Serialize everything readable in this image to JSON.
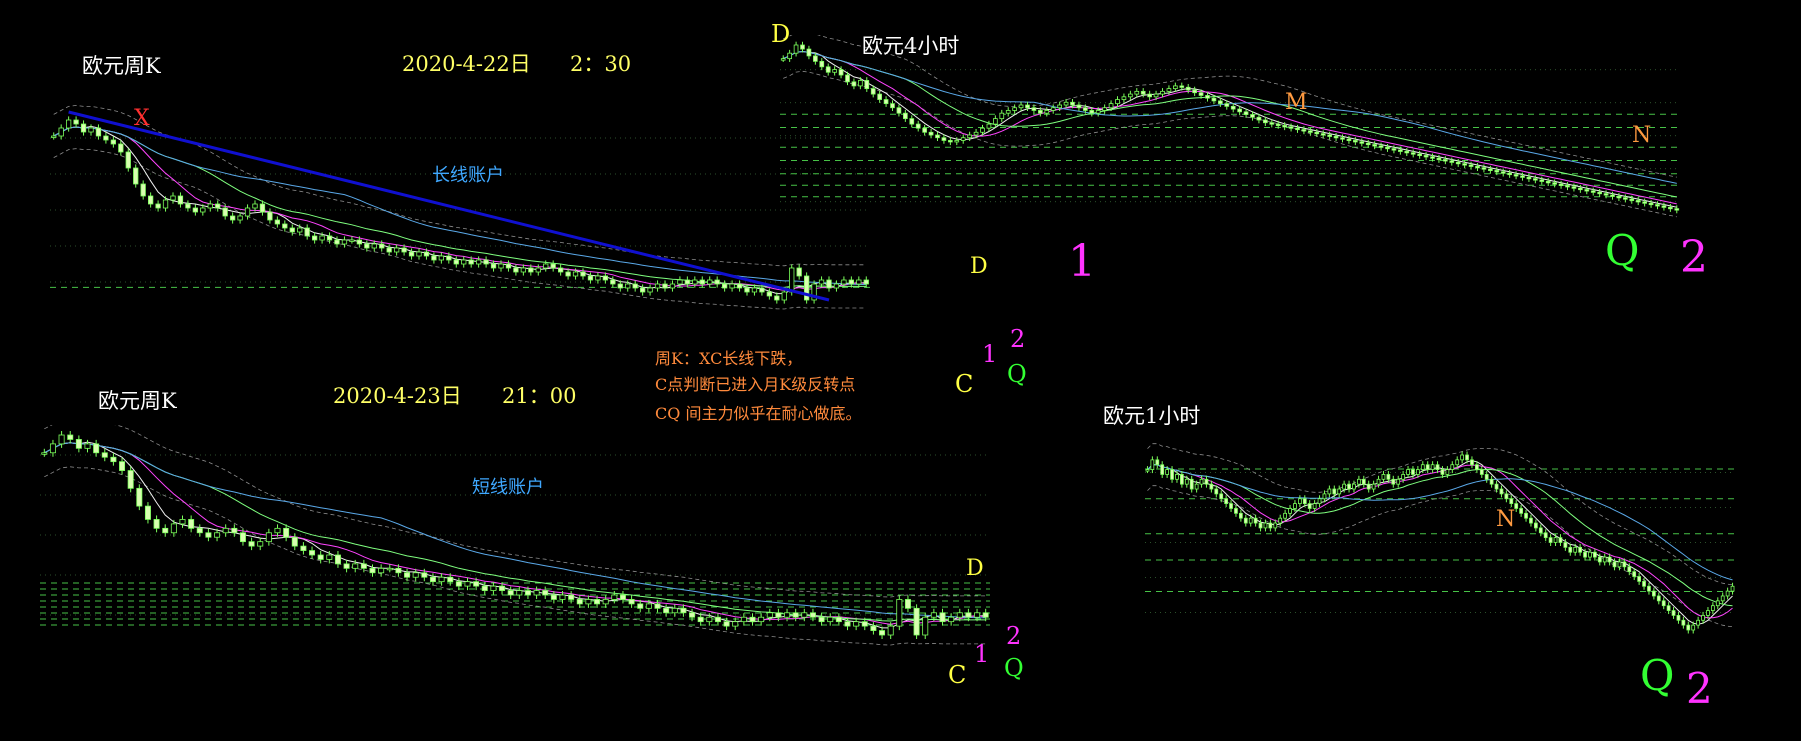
{
  "colors": {
    "background": "#000000",
    "candle": "#d8ffb0",
    "candle_border": "#7bff5a",
    "grid": "#3a6b3a",
    "level": "#47c247",
    "trend": "#1010d0",
    "ma_white": "#f0f0f0",
    "ma_magenta": "#ff44ff",
    "ma_green": "#7fff7f",
    "ma_blue": "#5aa8e8",
    "band": "#8c8c8c",
    "label_x": "#ff3030",
    "label_yellow": "#ffff44",
    "label_orange": "#ff9a40",
    "label_magenta": "#ff33ff",
    "label_green": "#33ff33",
    "account_text": "#3fa8ff",
    "note_text": "#ff8a3c"
  },
  "panel_weekly_top": {
    "title": "欧元周K",
    "date": "2020-4-22日",
    "time": "2：30",
    "account": "长线账户",
    "marker_x": "X",
    "marker_d": "D",
    "marker_c": "C",
    "marker_1": "1",
    "marker_2": "2",
    "marker_q": "Q"
  },
  "panel_4h": {
    "title": "欧元4小时",
    "marker_d": "D",
    "marker_m": "M",
    "marker_n": "N",
    "marker_1": "1",
    "marker_q": "Q",
    "marker_2": "2"
  },
  "panel_weekly_bottom": {
    "title": "欧元周K",
    "date": "2020-4-23日",
    "time": "21：00",
    "account": "短线账户",
    "marker_d": "D",
    "marker_c": "C",
    "marker_1": "1",
    "marker_2": "2",
    "marker_q": "Q"
  },
  "panel_1h": {
    "title": "欧元1小时",
    "marker_n": "N",
    "marker_q": "Q",
    "marker_2": "2"
  },
  "annotation": {
    "line1": "周K：XC长线下跌，",
    "line2": "C点判断已进入月K级反转点",
    "line3": "CQ 间主力似乎在耐心做底。"
  },
  "chart_data": [
    {
      "type": "candlestick",
      "panel": "weekly_top",
      "title": "欧元周K",
      "trendline": [
        "X",
        "C"
      ],
      "candles": 110,
      "close": [
        1.45,
        1.47,
        1.49,
        1.48,
        1.46,
        1.47,
        1.45,
        1.44,
        1.43,
        1.41,
        1.37,
        1.33,
        1.3,
        1.28,
        1.27,
        1.29,
        1.3,
        1.28,
        1.27,
        1.26,
        1.27,
        1.28,
        1.27,
        1.25,
        1.24,
        1.25,
        1.27,
        1.28,
        1.26,
        1.24,
        1.23,
        1.22,
        1.21,
        1.22,
        1.2,
        1.19,
        1.2,
        1.19,
        1.18,
        1.19,
        1.19,
        1.18,
        1.17,
        1.18,
        1.17,
        1.16,
        1.17,
        1.16,
        1.15,
        1.16,
        1.15,
        1.14,
        1.15,
        1.14,
        1.13,
        1.14,
        1.13,
        1.14,
        1.13,
        1.12,
        1.13,
        1.12,
        1.11,
        1.12,
        1.11,
        1.12,
        1.13,
        1.12,
        1.11,
        1.1,
        1.11,
        1.1,
        1.09,
        1.1,
        1.09,
        1.08,
        1.07,
        1.08,
        1.07,
        1.06,
        1.07,
        1.08,
        1.07,
        1.08,
        1.09,
        1.08,
        1.09,
        1.08,
        1.09,
        1.08,
        1.07,
        1.08,
        1.07,
        1.06,
        1.07,
        1.06,
        1.05,
        1.04,
        1.06,
        1.12,
        1.1,
        1.04,
        1.08,
        1.09,
        1.07,
        1.08,
        1.09,
        1.08,
        1.09,
        1.08
      ]
    },
    {
      "type": "candlestick",
      "panel": "4h",
      "title": "欧元4小时",
      "candles": 140,
      "close": [
        1.148,
        1.152,
        1.158,
        1.155,
        1.15,
        1.146,
        1.142,
        1.138,
        1.14,
        1.136,
        1.131,
        1.128,
        1.132,
        1.126,
        1.122,
        1.118,
        1.115,
        1.112,
        1.108,
        1.104,
        1.1,
        1.097,
        1.094,
        1.092,
        1.09,
        1.088,
        1.087,
        1.088,
        1.09,
        1.092,
        1.094,
        1.097,
        1.1,
        1.104,
        1.108,
        1.11,
        1.112,
        1.114,
        1.112,
        1.11,
        1.108,
        1.11,
        1.112,
        1.114,
        1.116,
        1.114,
        1.112,
        1.11,
        1.108,
        1.11,
        1.112,
        1.115,
        1.118,
        1.12,
        1.122,
        1.124,
        1.122,
        1.12,
        1.122,
        1.124,
        1.126,
        1.128,
        1.127,
        1.125,
        1.123,
        1.121,
        1.119,
        1.117,
        1.115,
        1.113,
        1.111,
        1.109,
        1.107,
        1.105,
        1.103,
        1.101,
        1.1,
        1.099,
        1.098,
        1.097,
        1.096,
        1.095,
        1.094,
        1.093,
        1.092,
        1.091,
        1.09,
        1.089,
        1.088,
        1.087,
        1.086,
        1.085,
        1.084,
        1.083,
        1.082,
        1.081,
        1.08,
        1.079,
        1.078,
        1.077,
        1.076,
        1.075,
        1.074,
        1.073,
        1.072,
        1.071,
        1.07,
        1.069,
        1.068,
        1.067,
        1.066,
        1.065,
        1.064,
        1.063,
        1.062,
        1.061,
        1.06,
        1.059,
        1.058,
        1.057,
        1.056,
        1.055,
        1.054,
        1.053,
        1.052,
        1.051,
        1.05,
        1.049,
        1.048,
        1.047,
        1.046,
        1.045,
        1.044,
        1.043,
        1.042,
        1.041,
        1.04,
        1.039,
        1.038,
        1.037
      ]
    },
    {
      "type": "candlestick",
      "panel": "weekly_bottom",
      "title": "欧元周K",
      "candles": 110,
      "close": [
        1.45,
        1.47,
        1.49,
        1.48,
        1.46,
        1.47,
        1.45,
        1.44,
        1.43,
        1.41,
        1.37,
        1.33,
        1.3,
        1.28,
        1.27,
        1.29,
        1.3,
        1.28,
        1.27,
        1.26,
        1.27,
        1.28,
        1.27,
        1.25,
        1.24,
        1.25,
        1.27,
        1.28,
        1.26,
        1.24,
        1.23,
        1.22,
        1.21,
        1.22,
        1.2,
        1.19,
        1.2,
        1.19,
        1.18,
        1.19,
        1.19,
        1.18,
        1.17,
        1.18,
        1.17,
        1.16,
        1.17,
        1.16,
        1.15,
        1.16,
        1.15,
        1.14,
        1.15,
        1.14,
        1.13,
        1.14,
        1.13,
        1.14,
        1.13,
        1.12,
        1.13,
        1.12,
        1.11,
        1.12,
        1.11,
        1.12,
        1.13,
        1.12,
        1.11,
        1.1,
        1.11,
        1.1,
        1.09,
        1.1,
        1.09,
        1.08,
        1.07,
        1.08,
        1.07,
        1.06,
        1.07,
        1.08,
        1.07,
        1.08,
        1.09,
        1.08,
        1.09,
        1.08,
        1.09,
        1.08,
        1.07,
        1.08,
        1.07,
        1.06,
        1.07,
        1.06,
        1.05,
        1.04,
        1.06,
        1.12,
        1.1,
        1.04,
        1.08,
        1.09,
        1.07,
        1.08,
        1.09,
        1.08,
        1.09,
        1.08
      ]
    },
    {
      "type": "candlestick",
      "panel": "1h",
      "title": "欧元1小时",
      "candles": 120,
      "close": [
        1.09,
        1.092,
        1.091,
        1.089,
        1.09,
        1.088,
        1.089,
        1.087,
        1.088,
        1.086,
        1.087,
        1.088,
        1.087,
        1.086,
        1.085,
        1.084,
        1.083,
        1.082,
        1.081,
        1.08,
        1.079,
        1.08,
        1.079,
        1.078,
        1.079,
        1.078,
        1.079,
        1.08,
        1.081,
        1.082,
        1.083,
        1.084,
        1.083,
        1.082,
        1.083,
        1.084,
        1.085,
        1.086,
        1.085,
        1.086,
        1.087,
        1.086,
        1.087,
        1.088,
        1.087,
        1.086,
        1.087,
        1.088,
        1.089,
        1.088,
        1.087,
        1.088,
        1.089,
        1.09,
        1.089,
        1.09,
        1.091,
        1.09,
        1.091,
        1.09,
        1.089,
        1.09,
        1.091,
        1.092,
        1.093,
        1.092,
        1.091,
        1.09,
        1.089,
        1.088,
        1.087,
        1.086,
        1.085,
        1.084,
        1.083,
        1.082,
        1.081,
        1.08,
        1.079,
        1.078,
        1.077,
        1.076,
        1.075,
        1.076,
        1.075,
        1.074,
        1.073,
        1.074,
        1.073,
        1.072,
        1.073,
        1.072,
        1.071,
        1.072,
        1.071,
        1.07,
        1.071,
        1.07,
        1.069,
        1.068,
        1.067,
        1.066,
        1.065,
        1.064,
        1.063,
        1.062,
        1.061,
        1.06,
        1.059,
        1.058,
        1.057,
        1.058,
        1.059,
        1.06,
        1.061,
        1.062,
        1.063,
        1.064,
        1.065,
        1.066
      ]
    }
  ]
}
